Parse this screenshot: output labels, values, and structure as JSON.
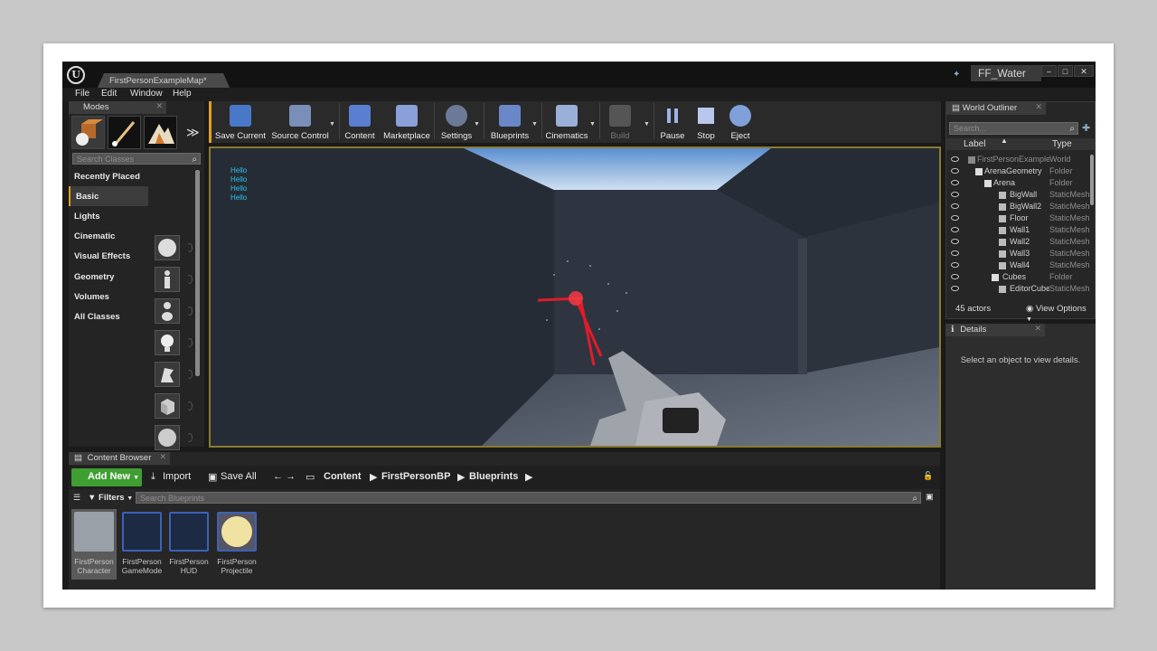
{
  "window": {
    "doc_tab": "FirstPersonExampleMap*",
    "project": "FF_Water",
    "logo": "U",
    "minimize": "–",
    "maximize": "□",
    "close": "✕"
  },
  "menu": [
    "File",
    "Edit",
    "Window",
    "Help"
  ],
  "modes": {
    "tab": "Modes",
    "search_placeholder": "Search Classes",
    "categories": [
      "Recently Placed",
      "Basic",
      "Lights",
      "Cinematic",
      "Visual Effects",
      "Geometry",
      "Volumes",
      "All Classes"
    ],
    "active_category": "Basic",
    "expand": "≫"
  },
  "toolbar": {
    "buttons": [
      "Save Current",
      "Source Control",
      "Content",
      "Marketplace",
      "Settings",
      "Blueprints",
      "Cinematics",
      "Build",
      "Pause",
      "Stop",
      "Eject"
    ]
  },
  "viewport": {
    "debug_lines": [
      "Hello",
      "Hello",
      "Hello",
      "Hello"
    ]
  },
  "outliner": {
    "tab": "World Outliner",
    "search_placeholder": "Search...",
    "col_label": "Label",
    "col_type": "Type",
    "rows": [
      {
        "label": "FirstPersonExampleMap",
        "type": "World"
      },
      {
        "label": "ArenaGeometry",
        "type": "Folder"
      },
      {
        "label": "Arena",
        "type": "Folder"
      },
      {
        "label": "BigWall",
        "type": "StaticMeshActor"
      },
      {
        "label": "BigWall2",
        "type": "StaticMeshActor"
      },
      {
        "label": "Floor",
        "type": "StaticMeshActor"
      },
      {
        "label": "Wall1",
        "type": "StaticMeshActor"
      },
      {
        "label": "Wall2",
        "type": "StaticMeshActor"
      },
      {
        "label": "Wall3",
        "type": "StaticMeshActor"
      },
      {
        "label": "Wall4",
        "type": "StaticMeshActor"
      },
      {
        "label": "Cubes",
        "type": "Folder"
      },
      {
        "label": "EditorCube",
        "type": "StaticMeshActor"
      }
    ],
    "actor_count": "45 actors",
    "view_options": "View Options"
  },
  "details": {
    "tab": "Details",
    "empty_message": "Select an object to view details."
  },
  "content_browser": {
    "tab": "Content Browser",
    "add_new": "Add New",
    "import": "Import",
    "save_all": "Save All",
    "path": [
      "Content",
      "FirstPersonBP",
      "Blueprints"
    ],
    "filters": "Filters",
    "search_placeholder": "Search Blueprints",
    "assets": [
      {
        "line1": "FirstPerson",
        "line2": "Character"
      },
      {
        "line1": "FirstPerson",
        "line2": "GameMode"
      },
      {
        "line1": "FirstPerson",
        "line2": "HUD"
      },
      {
        "line1": "FirstPerson",
        "line2": "Projectile"
      }
    ]
  },
  "colors": {
    "accent": "#e1a11a",
    "add_new_green": "#3f9e32",
    "hello_cyan": "#29c6e8"
  }
}
